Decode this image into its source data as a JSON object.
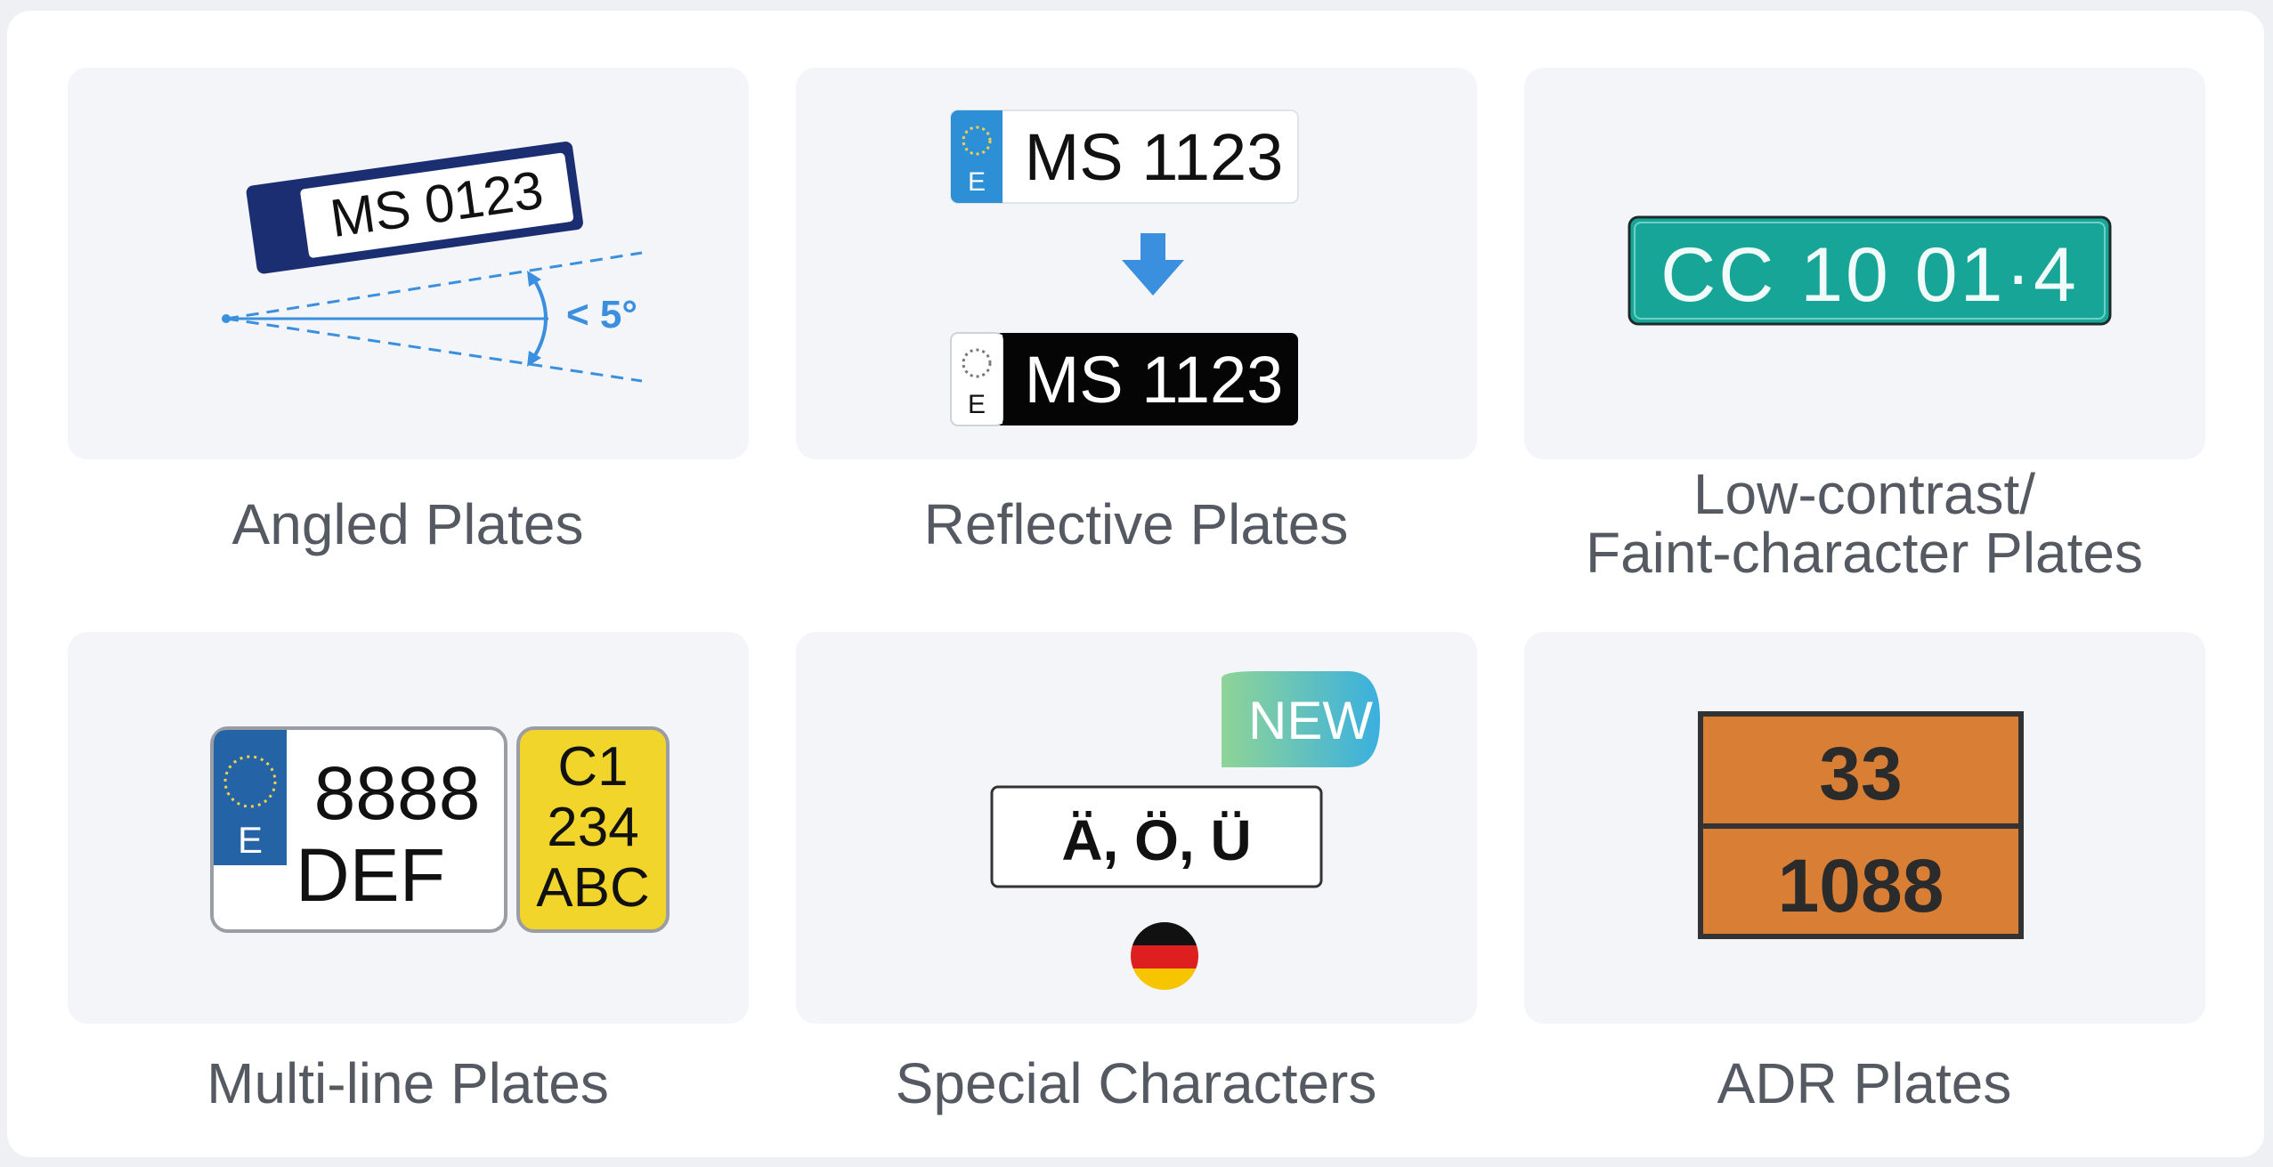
{
  "tiles": [
    {
      "key": "angled",
      "caption": "Angled Plates",
      "plate_text": "MS 0123",
      "angle_label": "< 5°",
      "colors": {
        "band": "#1c2e72",
        "guide": "#3a8fde"
      }
    },
    {
      "key": "reflective",
      "caption": "Reflective Plates",
      "plate_before": "MS 1123",
      "plate_after": "MS 1123",
      "country_code_before": "E",
      "country_code_after": "E",
      "arrow_icon": "arrow-down-icon",
      "colors": {
        "eu_band": "#2d8fd6",
        "arrow": "#3a8fde",
        "dark_plate": "#050505"
      }
    },
    {
      "key": "low-contrast",
      "caption_lines": [
        "Low-contrast/",
        "Faint-character Plates"
      ],
      "plate_text": "CC 10 01·4",
      "colors": {
        "plate": "#16a597"
      }
    },
    {
      "key": "multi-line",
      "caption": "Multi-line Plates",
      "plate_a": {
        "country_code": "E",
        "line1": "8888",
        "line2": "DEF"
      },
      "plate_b": {
        "line1": "C1",
        "line2": "234",
        "line3": "ABC"
      },
      "colors": {
        "eu_band": "#2463a6",
        "yellow": "#f1d52a"
      }
    },
    {
      "key": "special",
      "caption": "Special Characters",
      "badge": "NEW",
      "plate_text": "Ä, Ö, Ü",
      "flag_icon": "germany-flag-icon",
      "colors": {
        "badge_start": "#8fd497",
        "badge_end": "#3ab0df"
      }
    },
    {
      "key": "adr",
      "caption": "ADR Plates",
      "top_number": "33",
      "bottom_number": "1088",
      "colors": {
        "plate": "#d97f35",
        "border": "#333333"
      }
    }
  ]
}
